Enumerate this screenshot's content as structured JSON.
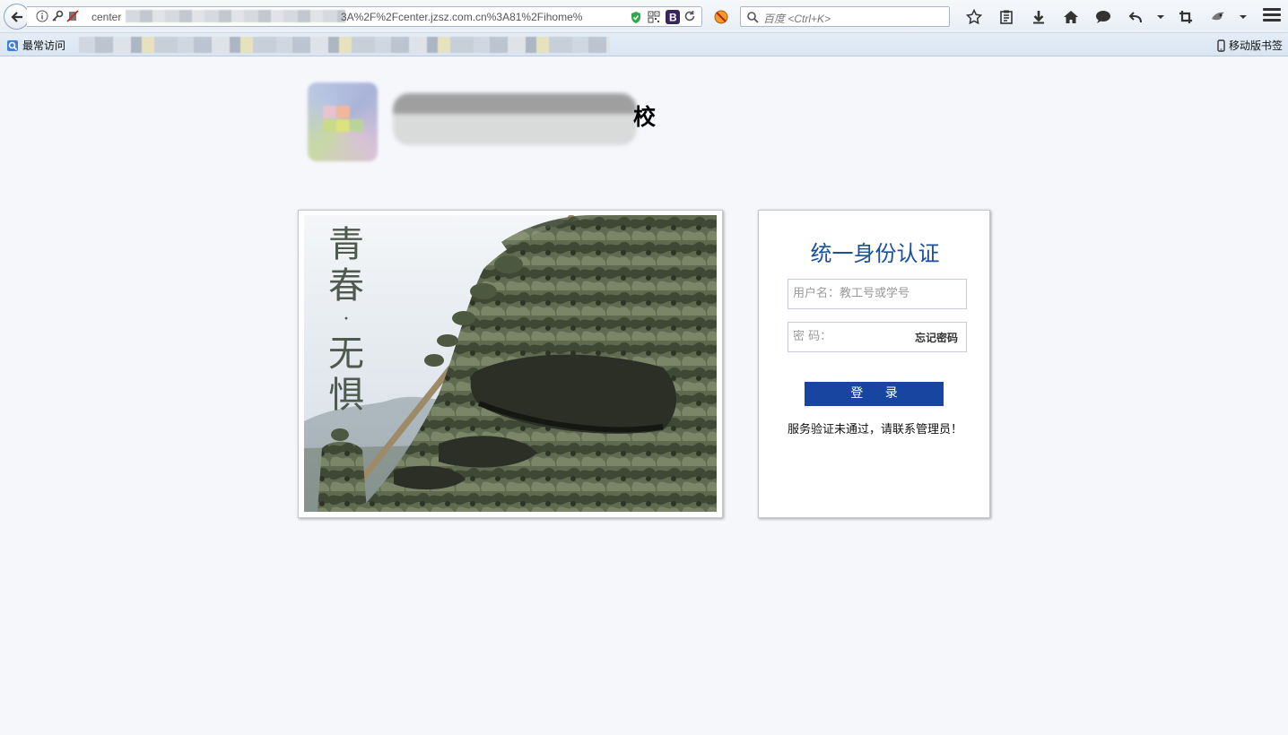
{
  "browser": {
    "url_text_start": "center",
    "url_text_end": "3A%2F%2Fcenter.jzsz.com.cn%3A81%2Fihome%",
    "search_placeholder": "百度 <Ctrl+K>",
    "bookmarks": {
      "most_visited": "最常访问",
      "mobile_bookmarks": "移动版书签"
    },
    "icons": [
      "back-arrow-icon",
      "info-icon",
      "key-icon",
      "blocked-icon",
      "shield-icon",
      "qr-code-icon",
      "bootstrap-icon",
      "reload-icon",
      "addon-icon",
      "search-icon",
      "star-icon",
      "reading-list-icon",
      "download-icon",
      "home-icon",
      "chat-icon",
      "undo-icon",
      "dropdown-icon",
      "crop-icon",
      "extension-icon",
      "menu-icon"
    ]
  },
  "page": {
    "school_name_suffix": "校",
    "poem": [
      "青",
      "春",
      "·",
      "无",
      "惧"
    ],
    "login": {
      "title": "统一身份认证",
      "username_placeholder": "用户名：教工号或学号",
      "password_label": "密 码：",
      "forgot_password": "忘记密码",
      "submit_label": "登 录",
      "error_message": "服务验证未通过，请联系管理员！"
    }
  },
  "colors": {
    "login_title": "#1a4fa0",
    "login_button": "#1845a0",
    "page_background": "#f5f7fb"
  }
}
